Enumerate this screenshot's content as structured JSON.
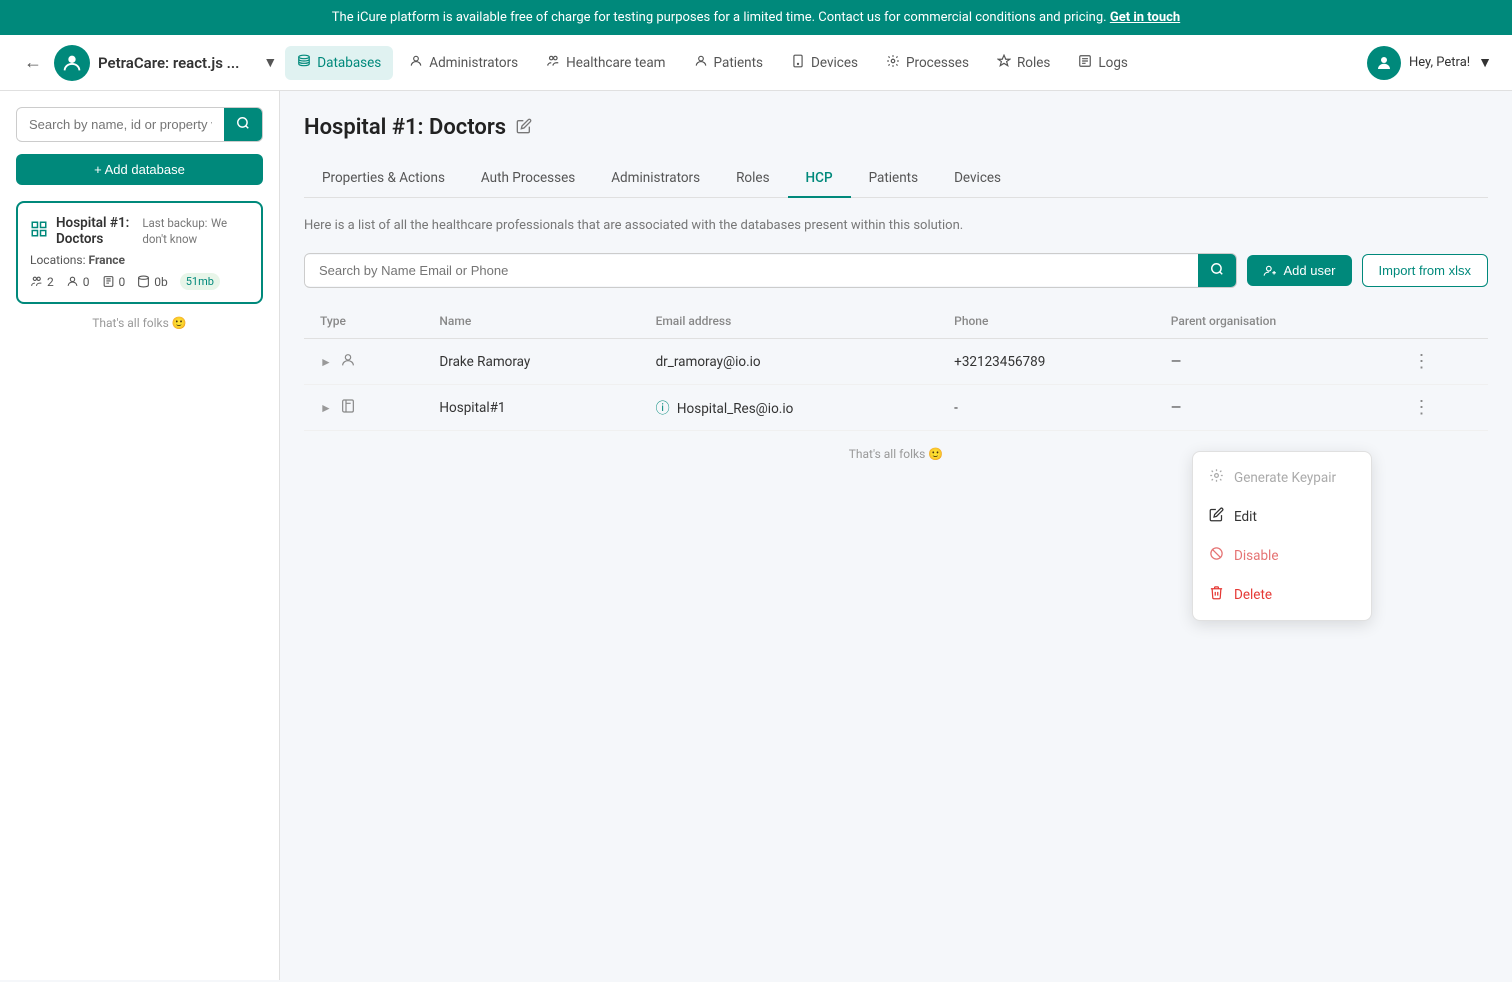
{
  "banner": {
    "text": "The iCure platform is available free of charge for testing purposes for a limited time. Contact us for commercial conditions and pricing.",
    "link_text": "Get in touch"
  },
  "navbar": {
    "brand_name": "PetraCare: react.js ...",
    "nav_items": [
      {
        "id": "databases",
        "label": "Databases",
        "icon": "🗄",
        "active": true
      },
      {
        "id": "administrators",
        "label": "Administrators",
        "icon": "👤"
      },
      {
        "id": "healthcare-team",
        "label": "Healthcare team",
        "icon": "👥"
      },
      {
        "id": "patients",
        "label": "Patients",
        "icon": "🧑"
      },
      {
        "id": "devices",
        "label": "Devices",
        "icon": "📱"
      },
      {
        "id": "processes",
        "label": "Processes",
        "icon": "🔑"
      },
      {
        "id": "roles",
        "label": "Roles",
        "icon": "🛡"
      },
      {
        "id": "logs",
        "label": "Logs",
        "icon": "📋"
      }
    ],
    "user_label": "Hey, Petra!"
  },
  "sidebar": {
    "search_placeholder": "Search by name, id or property value",
    "add_button_label": "+ Add database",
    "db_card": {
      "name": "Hospital #1: Doctors",
      "icon": "⊞",
      "backup_label": "Last backup:",
      "backup_value": "We don't know",
      "location_label": "Locations:",
      "location_value": "France",
      "stats": [
        {
          "icon": "👥",
          "value": "2"
        },
        {
          "icon": "👤",
          "value": "0"
        },
        {
          "icon": "📄",
          "value": "0"
        },
        {
          "icon": "💾",
          "value": "0b"
        },
        {
          "badge": "51mb"
        }
      ]
    },
    "footer_text": "That's all folks 🙂"
  },
  "content": {
    "page_title": "Hospital #1: Doctors",
    "tabs": [
      {
        "id": "properties",
        "label": "Properties & Actions"
      },
      {
        "id": "auth-processes",
        "label": "Auth Processes"
      },
      {
        "id": "administrators",
        "label": "Administrators"
      },
      {
        "id": "roles",
        "label": "Roles"
      },
      {
        "id": "hcp",
        "label": "HCP",
        "active": true
      },
      {
        "id": "patients",
        "label": "Patients"
      },
      {
        "id": "devices",
        "label": "Devices"
      }
    ],
    "description": "Here is a list of all the healthcare professionals that are associated with the databases present within this solution.",
    "search_placeholder": "Search by Name Email or Phone",
    "add_user_label": "Add user",
    "import_label": "Import from xlsx",
    "table": {
      "headers": [
        "Type",
        "Name",
        "Email address",
        "Phone",
        "Parent organisation"
      ],
      "rows": [
        {
          "type_icon": "👤",
          "name": "Drake Ramoray",
          "email": "dr_ramoray@io.io",
          "phone": "+32123456789",
          "parent": ""
        },
        {
          "type_icon": "🏥",
          "name": "Hospital#1",
          "email": "Hospital_Res@io.io",
          "email_info": true,
          "phone": "-",
          "parent": ""
        }
      ],
      "footer_text": "That's all folks 🙂"
    }
  },
  "context_menu": {
    "items": [
      {
        "id": "generate-keypair",
        "label": "Generate Keypair",
        "icon": "⚙",
        "disabled": true
      },
      {
        "id": "edit",
        "label": "Edit",
        "icon": "✏"
      },
      {
        "id": "disable",
        "label": "Disable",
        "icon": "🚫",
        "warn": true
      },
      {
        "id": "delete",
        "label": "Delete",
        "icon": "🗑",
        "danger": true
      }
    ]
  }
}
